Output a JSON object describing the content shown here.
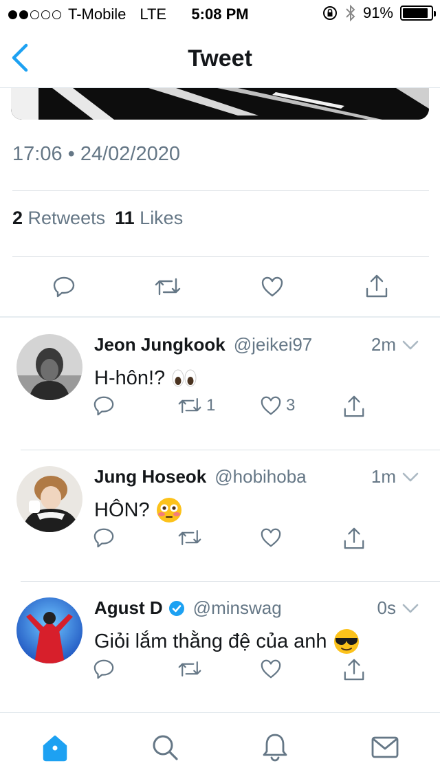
{
  "status": {
    "carrier": "T-Mobile",
    "network": "LTE",
    "time": "5:08 PM",
    "battery": "91%",
    "battery_level": 0.91
  },
  "nav": {
    "title": "Tweet",
    "back_icon": "chevron-left-icon"
  },
  "tweet": {
    "timestamp": "17:06 • 24/02/2020",
    "retweets_count": "2",
    "retweets_label": "Retweets",
    "likes_count": "11",
    "likes_label": "Likes"
  },
  "replies": [
    {
      "name": "Jeon Jungkook",
      "handle": "@jeikei97",
      "time": "2m",
      "text": "H-hôn!?",
      "emoji": "eyes-emoji",
      "retweets": "1",
      "likes": "3",
      "verified": false
    },
    {
      "name": "Jung Hoseok",
      "handle": "@hobihoba",
      "time": "1m",
      "text": "HÔN?",
      "emoji": "flushed-face-emoji",
      "retweets": "",
      "likes": "",
      "verified": false
    },
    {
      "name": "Agust D",
      "handle": "@minswag",
      "time": "0s",
      "text": "Giỏi lắm thằng đệ của anh",
      "emoji": "sunglasses-face-emoji",
      "retweets": "",
      "likes": "",
      "verified": true
    }
  ],
  "tabbar": {
    "items": [
      "home-icon",
      "search-icon",
      "notifications-icon",
      "messages-icon"
    ],
    "active": "home-icon"
  },
  "colors": {
    "accent": "#1da1f2",
    "icon_gray": "#657786",
    "text": "#14171a"
  }
}
